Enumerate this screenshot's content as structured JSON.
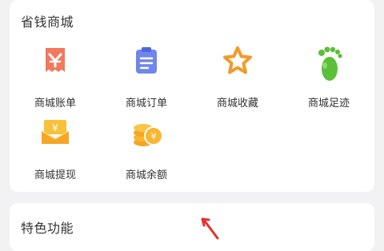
{
  "mall": {
    "title": "省钱商城",
    "items": [
      {
        "label": "商城账单",
        "icon": "bill-icon"
      },
      {
        "label": "商城订单",
        "icon": "clipboard-icon"
      },
      {
        "label": "商城收藏",
        "icon": "star-icon"
      },
      {
        "label": "商城足迹",
        "icon": "footprint-icon"
      },
      {
        "label": "商城提现",
        "icon": "wallet-yen-icon"
      },
      {
        "label": "商城余额",
        "icon": "coins-yen-icon"
      }
    ]
  },
  "features": {
    "title": "特色功能"
  },
  "colors": {
    "background": "#f2f2f4",
    "card": "#ffffff",
    "arrow": "#e8312e"
  }
}
